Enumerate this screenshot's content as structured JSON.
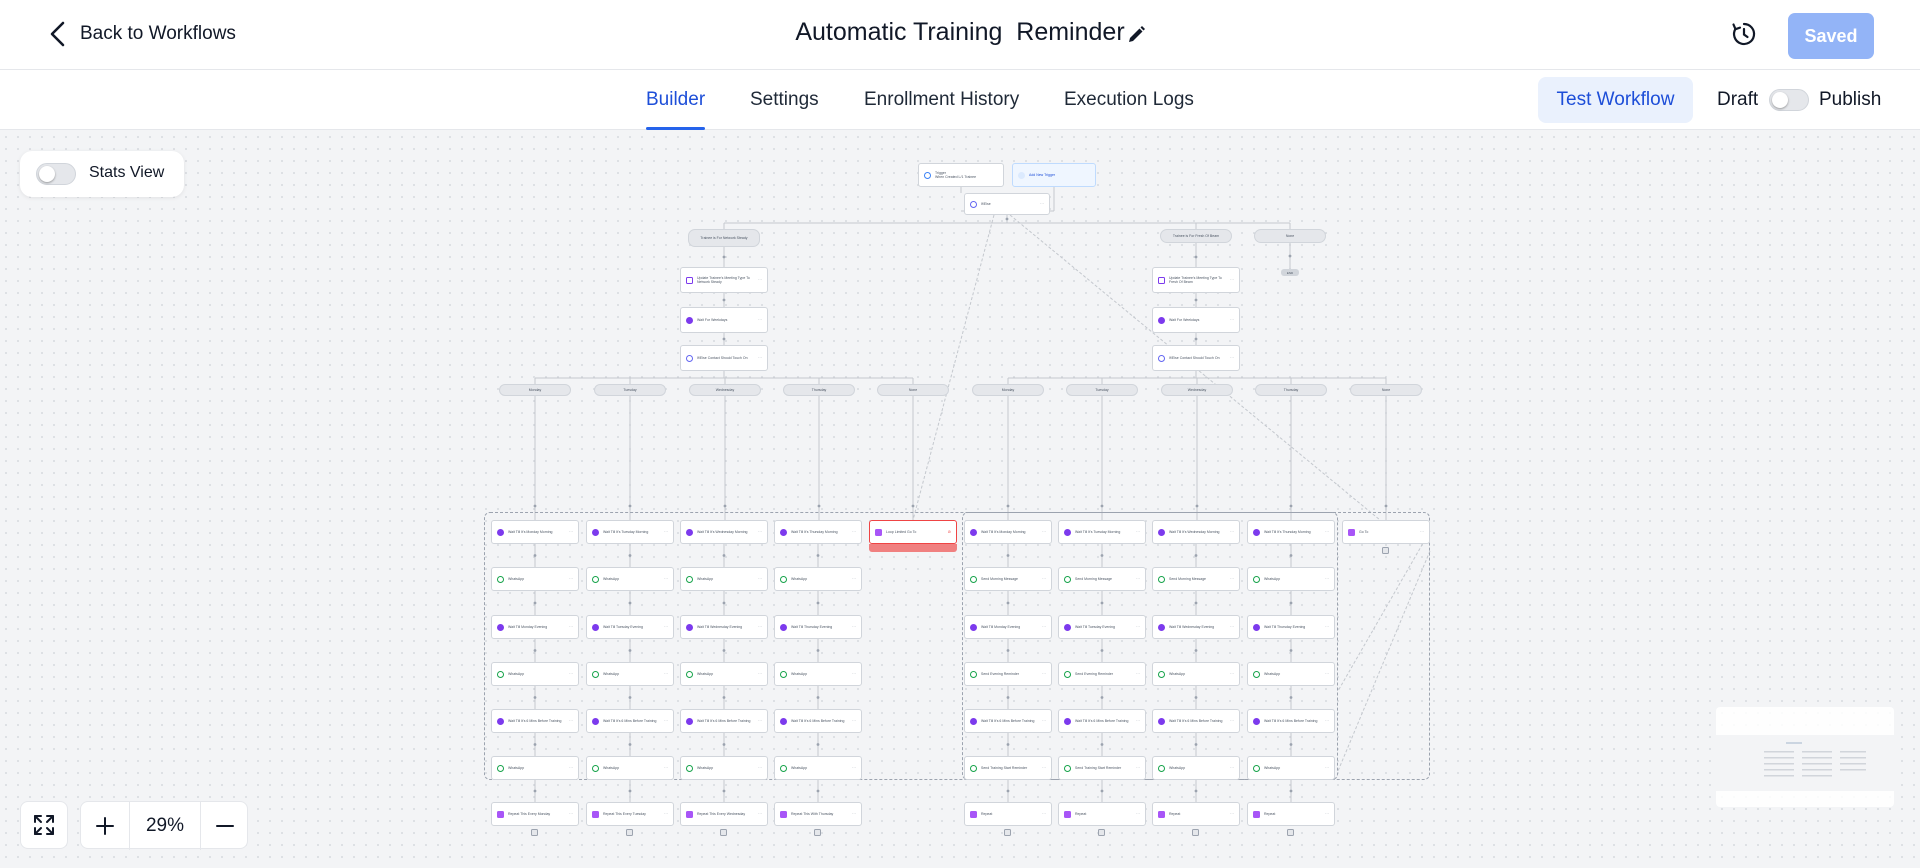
{
  "header": {
    "back_label": "Back to Workflows",
    "title": "Automatic Training  Reminder",
    "saved_label": "Saved"
  },
  "tabs": [
    {
      "label": "Builder",
      "active": true
    },
    {
      "label": "Settings"
    },
    {
      "label": "Enrollment History"
    },
    {
      "label": "Execution Logs"
    }
  ],
  "actions": {
    "test_label": "Test Workflow",
    "draft_label": "Draft",
    "publish_label": "Publish",
    "published": false
  },
  "canvas": {
    "stats_label": "Stats View",
    "stats_on": false,
    "zoom": "29%"
  },
  "flow": {
    "trigger": {
      "line1": "Trigger",
      "line2": "When Created L/1 Trainee"
    },
    "add_trigger": "Add New Trigger",
    "root_if": "If/Else",
    "branches": [
      "Trainee is For Network Steady",
      "Trainee is For Fresh Of Beam",
      "None"
    ],
    "end_label": "END",
    "left": {
      "update": "Update Trainee's Meeting Type To Network Steady",
      "wait": "Wait For Weekdays",
      "if": "If/Else Contact Should Touch On"
    },
    "right": {
      "update": "Update Trainee's Meeting Type To Fresh Of Beam",
      "wait": "Wait For Weekdays",
      "if": "If/Else Contact Should Touch On"
    },
    "day_labels": [
      "Monday",
      "Tuesday",
      "Wednesday",
      "Thursday",
      "None"
    ],
    "left_columns": [
      [
        "Wait Till It's Monday Morning",
        "WhatsApp",
        "Wait Till Monday Evening",
        "WhatsApp",
        "Wait Till It's 6 Mins Before Training",
        "WhatsApp",
        "Repeat This Every Monday"
      ],
      [
        "Wait Till It's Tuesday Morning",
        "WhatsApp",
        "Wait Till Tuesday Evening",
        "WhatsApp",
        "Wait Till It's 6 Mins Before Training",
        "WhatsApp",
        "Repeat This Every Tuesday"
      ],
      [
        "Wait Till It's Wednesday Morning",
        "WhatsApp",
        "Wait Till Wednesday Evening",
        "WhatsApp",
        "Wait Till It's 6 Mins Before Training",
        "WhatsApp",
        "Repeat This Every Wednesday"
      ],
      [
        "Wait Till It's Thursday Morning",
        "WhatsApp",
        "Wait Till Thursday Evening",
        "WhatsApp",
        "Wait Till It's 6 Mins Before Training",
        "WhatsApp",
        "Repeat This With Thursday"
      ]
    ],
    "loop_node": "Loop Limited Go To",
    "right_columns": [
      [
        "Wait Till It's Monday Morning",
        "Send Morning Message",
        "Wait Till Monday Evening",
        "Send Evening Reminder",
        "Wait Till It's 6 Mins Before Training",
        "Send Training Start Reminder",
        "Repeat"
      ],
      [
        "Wait Till It's Tuesday Morning",
        "Send Morning Message",
        "Wait Till Tuesday Evening",
        "Send Evening Reminder",
        "Wait Till It's 6 Mins Before Training",
        "Send Training Start Reminder",
        "Repeat"
      ],
      [
        "Wait Till It's Wednesday Morning",
        "Send Morning Message",
        "Wait Till Wednesday Evening",
        "WhatsApp",
        "Wait Till It's 6 Mins Before Training",
        "WhatsApp",
        "Repeat"
      ],
      [
        "Wait Till It's Thursday Morning",
        "WhatsApp",
        "Wait Till Thursday Evening",
        "WhatsApp",
        "Wait Till It's 6 Mins Before Training",
        "WhatsApp",
        "Repeat"
      ]
    ],
    "goto_node": "Go To"
  },
  "colors": {
    "accent": "#2563eb",
    "saved": "#93b4f7",
    "error": "#f08080"
  }
}
